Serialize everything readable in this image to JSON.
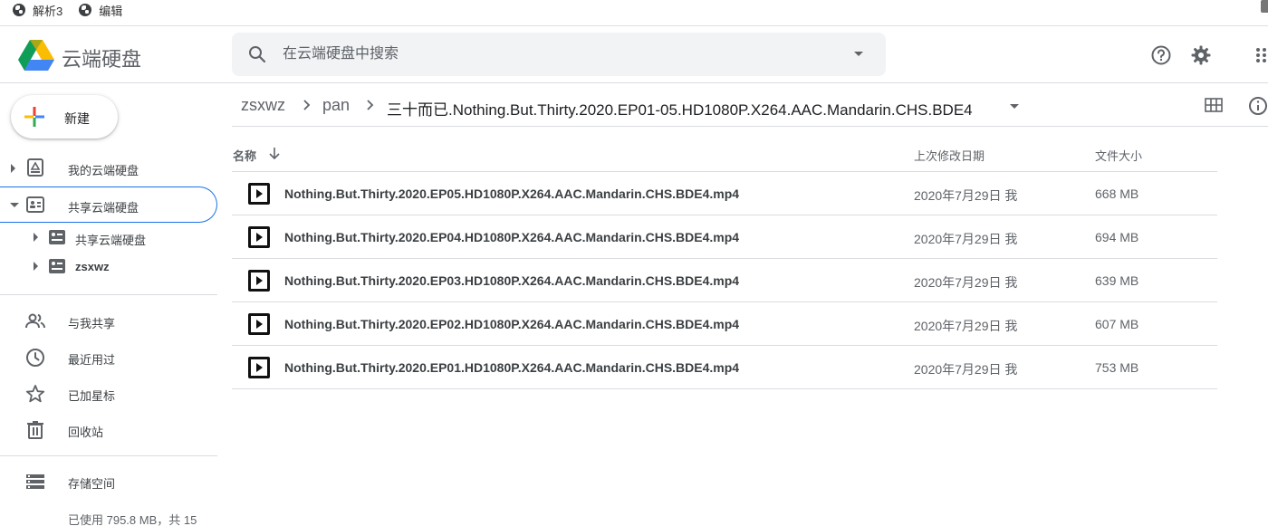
{
  "bookmarks": [
    {
      "label": "解析3",
      "icon": "globe-icon"
    },
    {
      "label": "编辑",
      "icon": "globe-icon"
    }
  ],
  "header": {
    "brand": "云端硬盘",
    "search_placeholder": "在云端硬盘中搜索",
    "icons": [
      "help-icon",
      "settings-icon",
      "apps-icon"
    ]
  },
  "sidebar": {
    "new_label": "新建",
    "my_drive": "我的云端硬盘",
    "shared_drives": "共享云端硬盘",
    "shared_children": [
      "共享云端硬盘",
      "zsxwz"
    ],
    "shared_with_me": "与我共享",
    "recent": "最近用过",
    "starred": "已加星标",
    "trash": "回收站",
    "storage": "存储空间",
    "storage_used": "已使用 795.8 MB，共 15"
  },
  "breadcrumb": {
    "items": [
      "zsxwz",
      "pan",
      "三十而已.Nothing.But.Thirty.2020.EP01-05.HD1080P.X264.AAC.Mandarin.CHS.BDE4"
    ]
  },
  "file_list": {
    "columns": {
      "name": "名称",
      "modified": "上次修改日期",
      "size": "文件大小"
    },
    "rows": [
      {
        "name": "Nothing.But.Thirty.2020.EP05.HD1080P.X264.AAC.Mandarin.CHS.BDE4.mp4",
        "modified": "2020年7月29日 我",
        "size": "668 MB"
      },
      {
        "name": "Nothing.But.Thirty.2020.EP04.HD1080P.X264.AAC.Mandarin.CHS.BDE4.mp4",
        "modified": "2020年7月29日 我",
        "size": "694 MB"
      },
      {
        "name": "Nothing.But.Thirty.2020.EP03.HD1080P.X264.AAC.Mandarin.CHS.BDE4.mp4",
        "modified": "2020年7月29日 我",
        "size": "639 MB"
      },
      {
        "name": "Nothing.But.Thirty.2020.EP02.HD1080P.X264.AAC.Mandarin.CHS.BDE4.mp4",
        "modified": "2020年7月29日 我",
        "size": "607 MB"
      },
      {
        "name": "Nothing.But.Thirty.2020.EP01.HD1080P.X264.AAC.Mandarin.CHS.BDE4.mp4",
        "modified": "2020年7月29日 我",
        "size": "753 MB"
      }
    ]
  },
  "colors": {
    "accent": "#1a73e8",
    "text": "#202124",
    "muted": "#5f6368",
    "divider": "#dadce0"
  }
}
